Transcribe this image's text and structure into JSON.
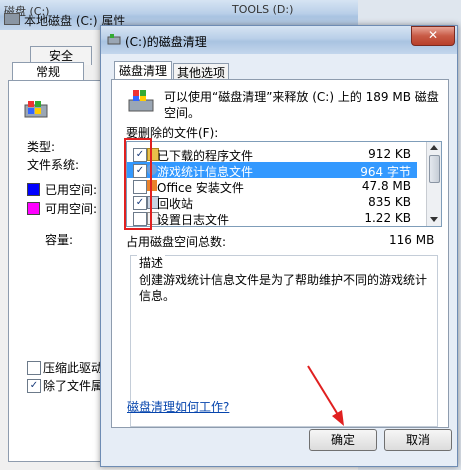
{
  "bg_window": {
    "title": "本地磁盘 (C:) 属性",
    "other_title": "TOOLS (D:)",
    "top_fragment": "磁盘 (C:)",
    "tabs": [
      "安全",
      "常规"
    ],
    "type_label": "类型:",
    "fs_label": "文件系统:",
    "used_label": "已用空间:",
    "free_label": "可用空间:",
    "capacity_label": "容量:",
    "compress_label": "压缩此驱动",
    "index_label": "除了文件属",
    "used_color": "#0000ff",
    "free_color": "#ff00ff"
  },
  "dialog": {
    "title": "(C:)的磁盘清理",
    "close_glyph": "✕",
    "tabs": [
      "磁盘清理",
      "其他选项"
    ],
    "intro": "可以使用“磁盘清理”来释放 (C:) 上的 189 MB 磁盘空间。",
    "files_label": "要删除的文件(F):",
    "files": [
      {
        "name": "已下载的程序文件",
        "size": "912 KB",
        "checked": true,
        "selected": false
      },
      {
        "name": "游戏统计信息文件",
        "size": "964 字节",
        "checked": true,
        "selected": true
      },
      {
        "name": "Office 安装文件",
        "size": "47.8 MB",
        "checked": false,
        "selected": false
      },
      {
        "name": "回收站",
        "size": "835 KB",
        "checked": true,
        "selected": false
      },
      {
        "name": "设置日志文件",
        "size": "1.22 KB",
        "checked": false,
        "selected": false
      }
    ],
    "total_label": "占用磁盘空间总数:",
    "total_value": "116 MB",
    "desc_title": "描述",
    "desc_text": "创建游戏统计信息文件是为了帮助维护不同的游戏统计信息。",
    "help_link": "磁盘清理如何工作?",
    "ok_label": "确定",
    "cancel_label": "取消"
  },
  "accent": {
    "highlight": "#3399ff",
    "annotation": "#e02020"
  }
}
